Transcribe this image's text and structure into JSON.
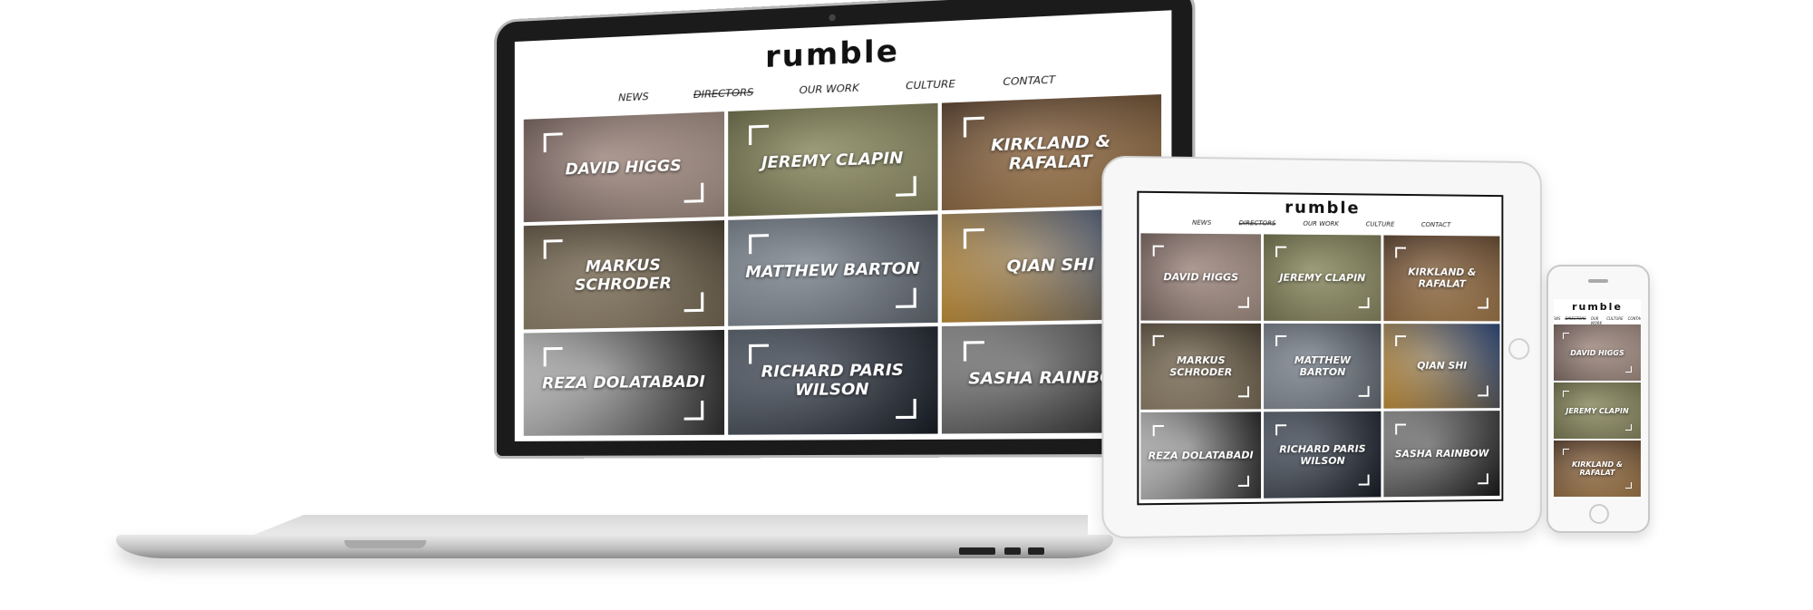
{
  "site": {
    "logo": "rumble",
    "nav": [
      {
        "label": "NEWS",
        "active": false
      },
      {
        "label": "DIRECTORS",
        "active": true
      },
      {
        "label": "OUR WORK",
        "active": false
      },
      {
        "label": "CULTURE",
        "active": false
      },
      {
        "label": "CONTACT",
        "active": false
      }
    ]
  },
  "directors": [
    {
      "name": "DAVID HIGGS",
      "colors": [
        "#7b6560",
        "#c8b0a2"
      ]
    },
    {
      "name": "JEREMY CLAPIN",
      "colors": [
        "#6f7048",
        "#a9a779"
      ]
    },
    {
      "name": "KIRKLAND & RAFALAT",
      "colors": [
        "#5a3f2b",
        "#c6955b"
      ]
    },
    {
      "name": "MARKUS SCHRODER",
      "colors": [
        "#4f4433",
        "#a59478"
      ]
    },
    {
      "name": "MATTHEW BARTON",
      "colors": [
        "#58606b",
        "#9aa3ad"
      ]
    },
    {
      "name": "QIAN SHI",
      "colors": [
        "#2f4f8a",
        "#e2a53d"
      ]
    },
    {
      "name": "REZA DOLATABADI",
      "colors": [
        "#2a2a2a",
        "#d6d6d6"
      ]
    },
    {
      "name": "RICHARD PARIS WILSON",
      "colors": [
        "#1d232e",
        "#5b6470"
      ]
    },
    {
      "name": "SASHA RAINBOW",
      "colors": [
        "#202020",
        "#9a9a9a"
      ]
    }
  ],
  "phone_tiles": [
    {
      "name": "DAVID HIGGS",
      "colors": [
        "#7b6560",
        "#c8b0a2"
      ]
    },
    {
      "name": "JEREMY CLAPIN",
      "colors": [
        "#6f7048",
        "#a9a779"
      ]
    },
    {
      "name": "KIRKLAND & RAFALAT",
      "colors": [
        "#5a3f2b",
        "#c6955b"
      ]
    }
  ]
}
